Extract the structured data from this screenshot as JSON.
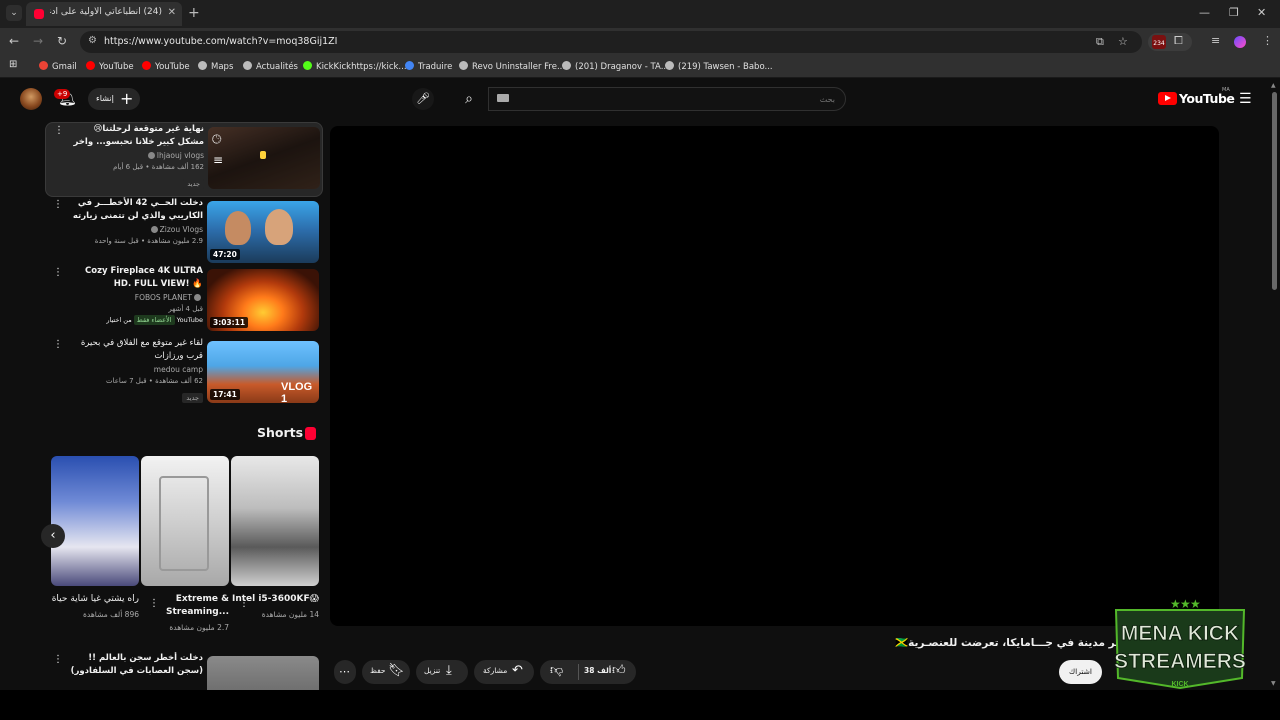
{
  "browser": {
    "tab_title": "(24) انطباعاتي الأولية على أدغال...",
    "url": "https://www.youtube.com/watch?v=moq38Gij1ZI",
    "extension_badge": "234",
    "bookmarks": [
      {
        "label": "Gmail",
        "color": "#ea4335"
      },
      {
        "label": "YouTube",
        "color": "#ff0000"
      },
      {
        "label": "YouTube",
        "color": "#ff0000"
      },
      {
        "label": "Maps",
        "color": "#bbbbbb"
      },
      {
        "label": "Actualités",
        "color": "#bbbbbb"
      },
      {
        "label": "KickKickhttps://kick...",
        "color": "#53fc18"
      },
      {
        "label": "Traduire",
        "color": "#4285f4"
      },
      {
        "label": "Revo Uninstaller Fre...",
        "color": "#bbbbbb"
      },
      {
        "label": "(201) Draganov - TA...",
        "color": "#bbbbbb"
      },
      {
        "label": "(219) Tawsen - Babo...",
        "color": "#bbbbbb"
      }
    ]
  },
  "youtube": {
    "notif_badge": "+9",
    "create_label": "إنشاء",
    "search_placeholder": "بحث",
    "logo_text": "YouTube",
    "logo_country": "MA"
  },
  "recommendations": [
    {
      "title": "نهاية غير متوقعة لرحلتنا😢 مشكل كبير خلانا نحبسو... واخر فطور فالصحراء ...",
      "channel": "lhjaouj vlogs",
      "stats": "162 ألف مشاهدة • قبل 6 أيام",
      "badge": "جديد",
      "duration": ""
    },
    {
      "title": "دخلت الحــي 42 الأخطـــر في الكاريبي والذي لن تتمنى زيارته🇩🇴",
      "channel": "Zizou Vlogs",
      "stats": "2.9 مليون مشاهدة • قبل سنة واحدة",
      "badge": "",
      "duration": "47:20"
    },
    {
      "title": "Cozy Fireplace 4K ULTRA HD. FULL VIEW! 🔥",
      "channel": "FOBOS PLANET",
      "stats": "قبل 4 أشهر",
      "badge": "من اختيار YouTube",
      "badge2": "الأعضاء فقط",
      "duration": "3:03:11"
    },
    {
      "title": "لقاء غير متوقع مع الفلاق في بحيرة قرب ورزازات",
      "channel": "medou camp",
      "stats": "62 ألف مشاهدة • قبل 7 ساعات",
      "badge": "جديد",
      "duration": "17:41"
    },
    {
      "title": "دخلت أخطر سجن بالعالم !! (سجن العصابات في السلفادور) CECOT sv",
      "channel": "",
      "stats": "",
      "badge": "",
      "duration": ""
    }
  ],
  "shorts": {
    "heading": "Shorts",
    "items": [
      {
        "title": "Intel i5-3600KF😱",
        "views": "14 مليون مشاهدة"
      },
      {
        "title": "Extreme & Streaming...",
        "views": "2.7 مليون مشاهدة"
      },
      {
        "title": "راه يشتي غيا شاية حياة",
        "views": "896 ألف مشاهدة"
      }
    ]
  },
  "watch": {
    "title": "خطــر مدينة في جـــامايكا، تعرضت للعنصـرية🇯🇲",
    "like_count": "38 ألف",
    "share_label": "مشاركة",
    "download_label": "تنزيل",
    "save_label": "حفظ",
    "subscribe_label": "اشتراك"
  },
  "watermark": {
    "line1": "MENA KICK",
    "line2": "STREAMERS",
    "tag": "KICK"
  }
}
